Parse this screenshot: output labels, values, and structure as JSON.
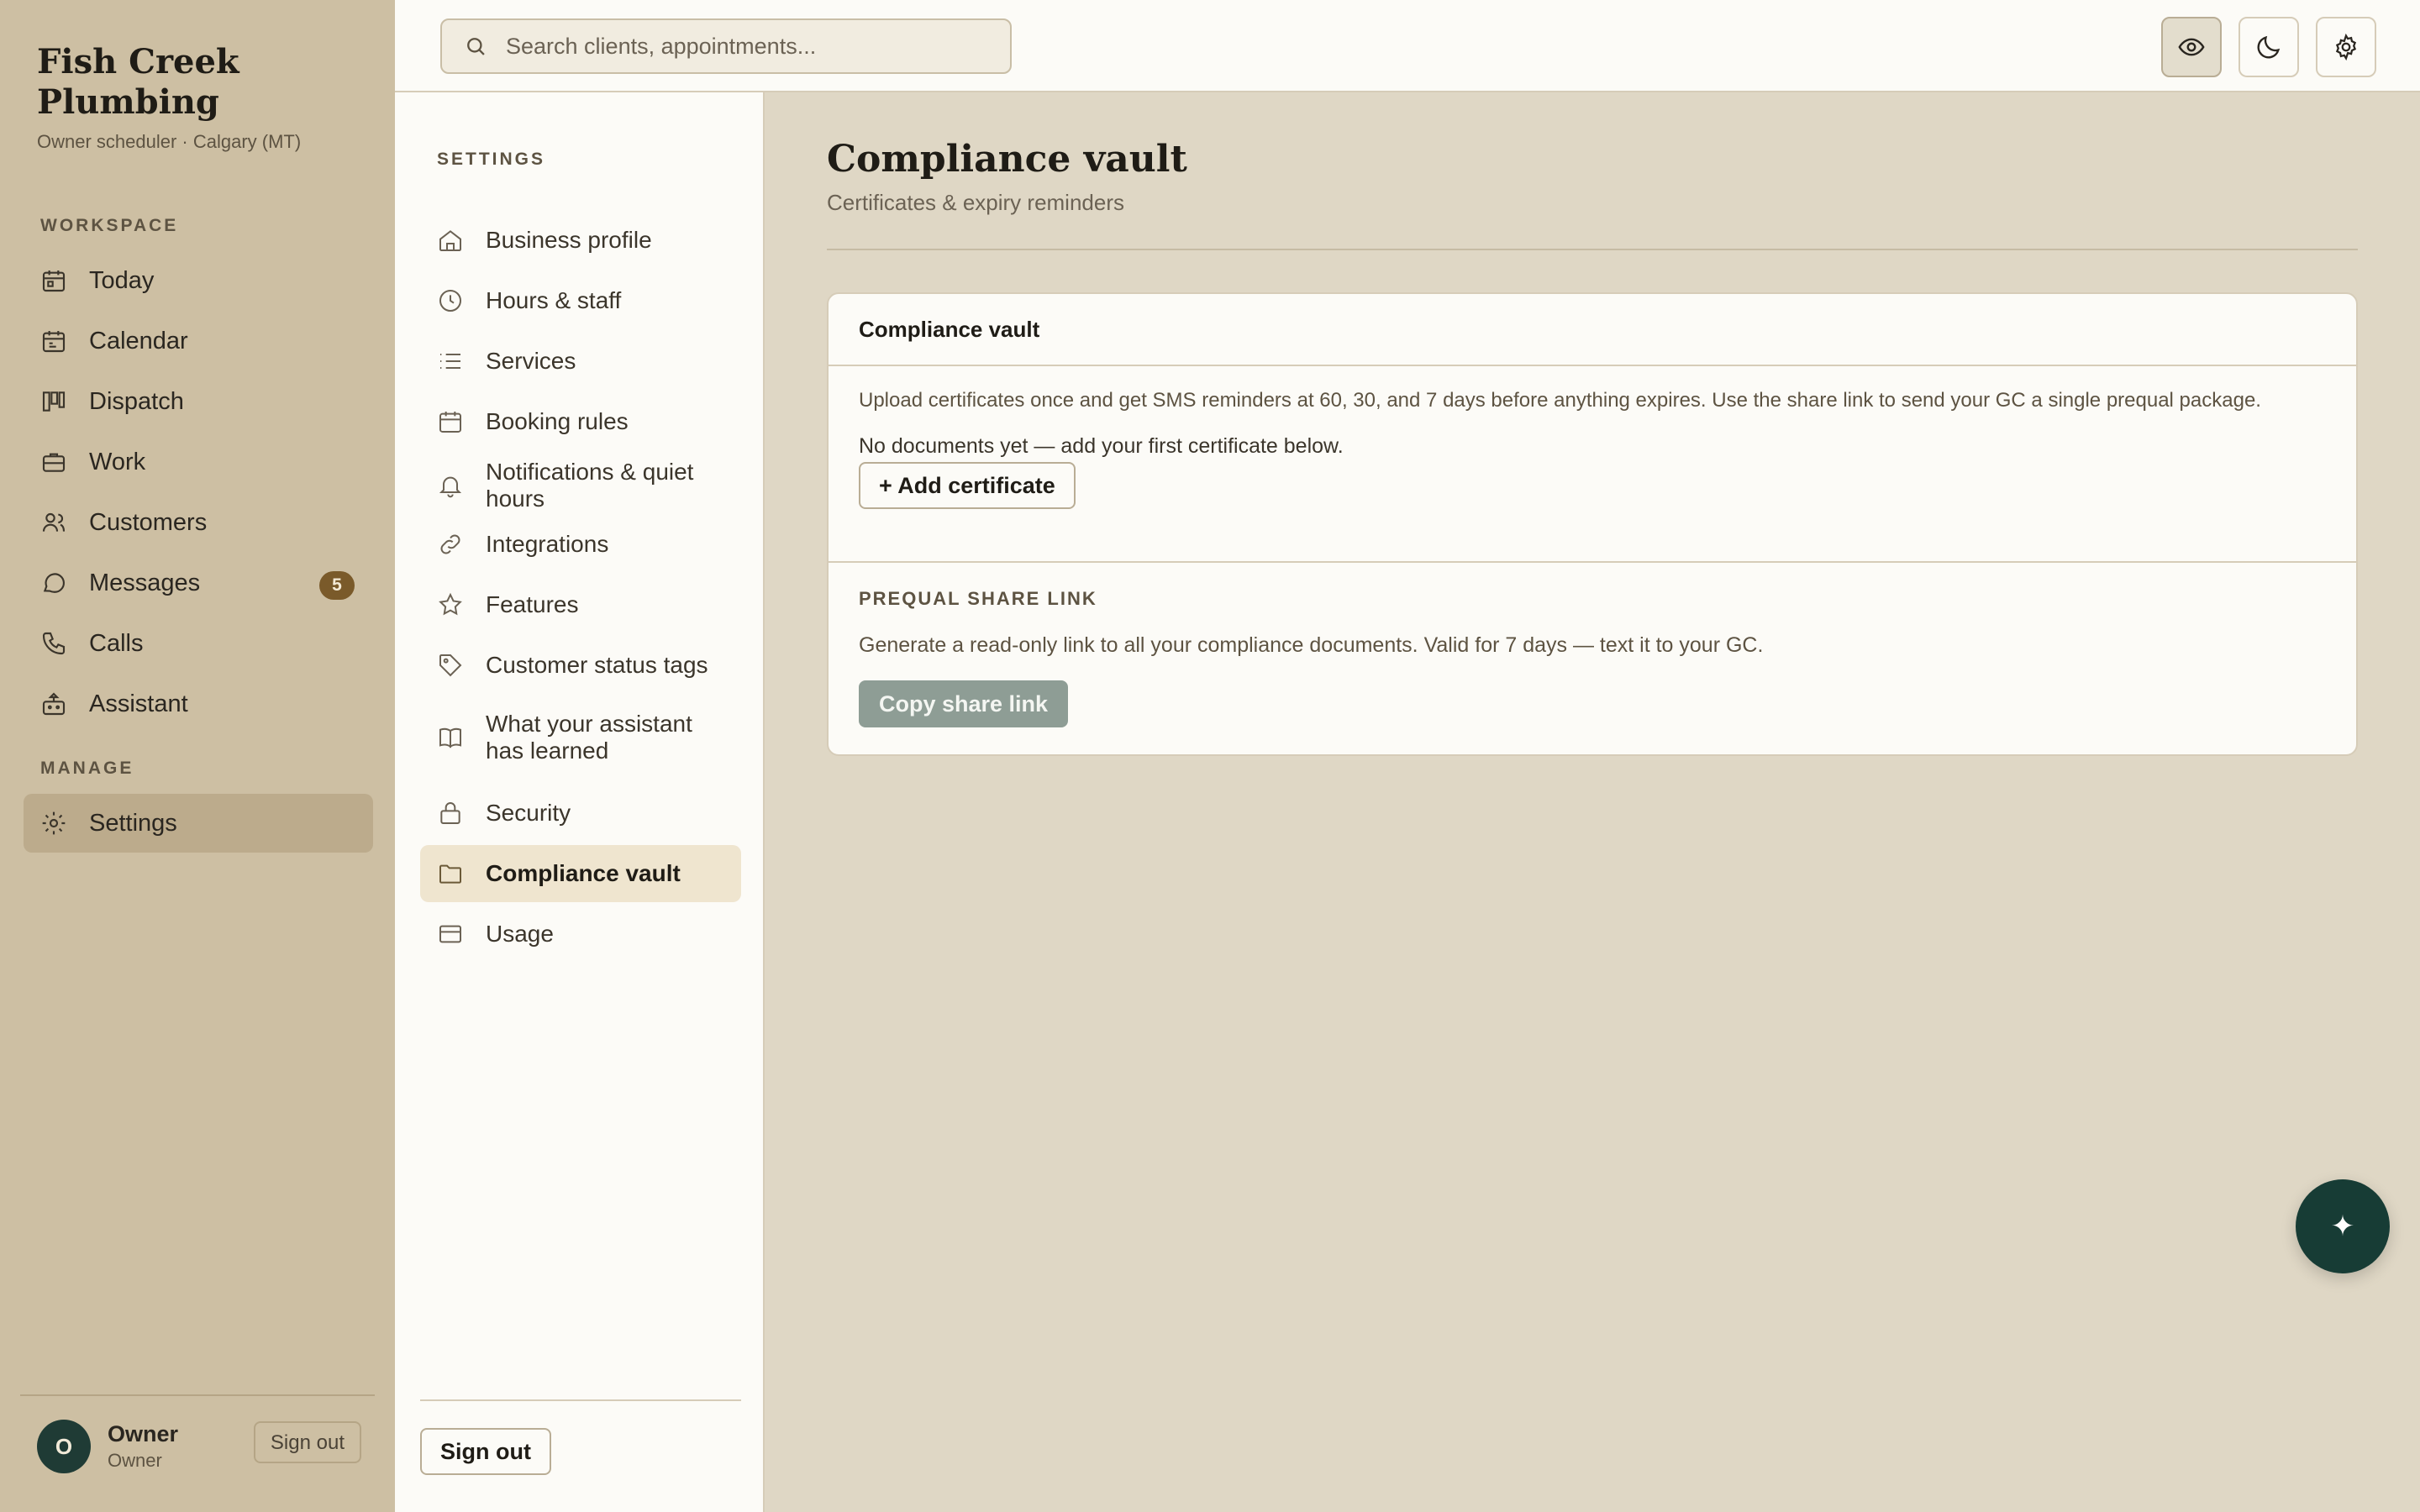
{
  "brand": {
    "name": "Fish Creek Plumbing",
    "subtitle": "Owner scheduler · Calgary (MT)"
  },
  "sidebar": {
    "workspace_label": "WORKSPACE",
    "manage_label": "MANAGE",
    "items": [
      {
        "label": "Today",
        "icon": "calendar-day-icon"
      },
      {
        "label": "Calendar",
        "icon": "calendar-icon"
      },
      {
        "label": "Dispatch",
        "icon": "kanban-icon"
      },
      {
        "label": "Work",
        "icon": "briefcase-icon"
      },
      {
        "label": "Customers",
        "icon": "users-icon"
      },
      {
        "label": "Messages",
        "icon": "chat-icon",
        "badge": "5"
      },
      {
        "label": "Calls",
        "icon": "phone-icon"
      },
      {
        "label": "Assistant",
        "icon": "bot-icon"
      }
    ],
    "manage_items": [
      {
        "label": "Settings",
        "icon": "gear-icon",
        "active": true
      }
    ],
    "user": {
      "initial": "O",
      "name": "Owner",
      "role": "Owner",
      "signout": "Sign out"
    }
  },
  "topbar": {
    "search_placeholder": "Search clients, appointments...",
    "buttons": [
      "eye-icon",
      "moon-icon",
      "gear-icon"
    ]
  },
  "settings_nav": {
    "label": "SETTINGS",
    "items": [
      {
        "label": "Business profile",
        "icon": "home-icon"
      },
      {
        "label": "Hours & staff",
        "icon": "clock-icon"
      },
      {
        "label": "Services",
        "icon": "list-icon"
      },
      {
        "label": "Booking rules",
        "icon": "calendar-icon"
      },
      {
        "label": "Notifications & quiet hours",
        "icon": "bell-icon"
      },
      {
        "label": "Integrations",
        "icon": "link-icon"
      },
      {
        "label": "Features",
        "icon": "star-icon"
      },
      {
        "label": "Customer status tags",
        "icon": "tag-icon"
      },
      {
        "label": "What your assistant has learned",
        "icon": "book-icon"
      },
      {
        "label": "Security",
        "icon": "lock-icon"
      },
      {
        "label": "Compliance vault",
        "icon": "folder-icon",
        "active": true
      },
      {
        "label": "Usage",
        "icon": "credit-card-icon"
      }
    ],
    "signout": "Sign out"
  },
  "main": {
    "title": "Compliance vault",
    "subtitle": "Certificates & expiry reminders",
    "card": {
      "title": "Compliance vault",
      "intro": "Upload certificates once and get SMS reminders at 60, 30, and 7 days before anything expires. Use the share link to send your GC a single prequal package.",
      "empty": "No documents yet — add your first certificate below.",
      "add_button": "+ Add certificate",
      "prequal_label": "PREQUAL SHARE LINK",
      "prequal_desc": "Generate a read-only link to all your compliance documents. Valid for 7 days — text it to your GC.",
      "copy_button": "Copy share link"
    }
  },
  "fab": {
    "icon": "sparkle-icon",
    "glyph": "✦"
  },
  "colors": {
    "sidebar": "#cdbfa3",
    "background": "#dfd7c5",
    "accent": "#173c35",
    "badge": "#7a5a2a"
  }
}
